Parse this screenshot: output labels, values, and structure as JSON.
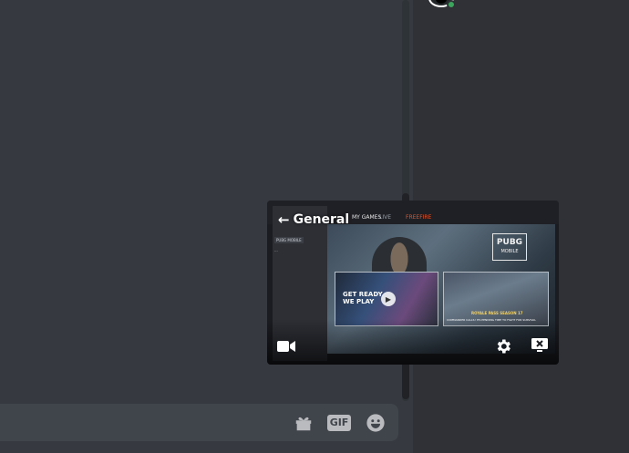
{
  "colors": {
    "background": "#36393f",
    "member_list": "#2f3136",
    "composer": "#40444b",
    "icon_gray": "#b9bbbe",
    "online": "#3ba55c",
    "stream_accent": "#e2542c"
  },
  "composer": {
    "gift_icon": "gift-icon",
    "gif_label": "GIF",
    "emoji_icon": "emoji-icon"
  },
  "pip": {
    "title": "General",
    "back_icon": "arrow-left-icon",
    "video_icon": "video-camera-icon",
    "settings_icon": "gear-icon",
    "popout_icon": "screen-close-icon",
    "stream": {
      "tabs": [
        "MY GAMES",
        "LIVE",
        "FREEFIRE"
      ],
      "sidebar_items": [
        "PUBG MOBILE",
        "..."
      ],
      "hero_logo": "PUBG",
      "hero_logo_sub": "MOBILE",
      "card_left_text": "GET READY\nWE PLAY",
      "card_right_text": "ROYALE PASS SEASON 17",
      "card_right_sub": "COMMANDER CALLS! ITS PENDING TIME TO FIGHT FOR SURVIVAL"
    }
  }
}
